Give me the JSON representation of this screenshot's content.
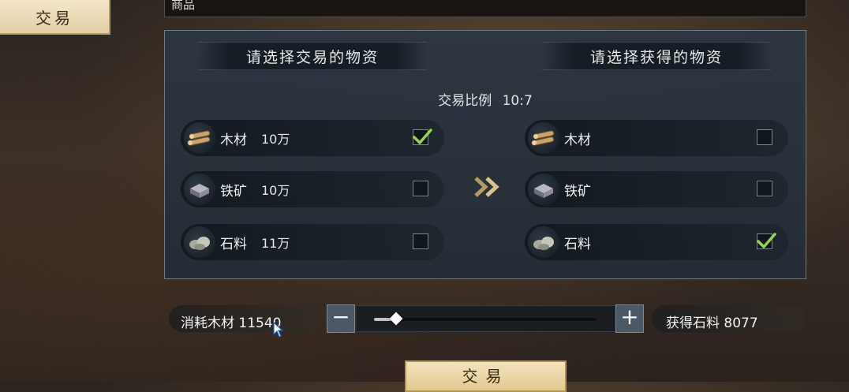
{
  "sidebar": {
    "active_tab": "交易"
  },
  "top_field": {
    "text": "商品"
  },
  "panel": {
    "give_header": "请选择交易的物资",
    "get_header": "请选择获得的物资",
    "ratio_label": "交易比例",
    "ratio_value": "10:7",
    "give_items": [
      {
        "label": "木材",
        "amount": "10万",
        "icon": "wood-icon",
        "checked": true
      },
      {
        "label": "铁矿",
        "amount": "10万",
        "icon": "iron-ore-icon",
        "checked": false
      },
      {
        "label": "石料",
        "amount": "11万",
        "icon": "stone-icon",
        "checked": false
      }
    ],
    "get_items": [
      {
        "label": "木材",
        "icon": "wood-icon",
        "checked": false
      },
      {
        "label": "铁矿",
        "icon": "iron-ore-icon",
        "checked": false
      },
      {
        "label": "石料",
        "icon": "stone-icon",
        "checked": true
      }
    ],
    "transfer_icon": "double-chevron-right-icon"
  },
  "controls": {
    "consume_label": "消耗木材",
    "consume_value": "11540",
    "minus_label": "−",
    "plus_label": "+",
    "slider_fraction": 0.1,
    "gain_label": "获得石料",
    "gain_value": "8077"
  },
  "trade_button": {
    "label": "交易"
  },
  "colors": {
    "check": "#8fd64a",
    "accent_gold": "#e1c98f",
    "panel_bg": "#2c3642"
  }
}
